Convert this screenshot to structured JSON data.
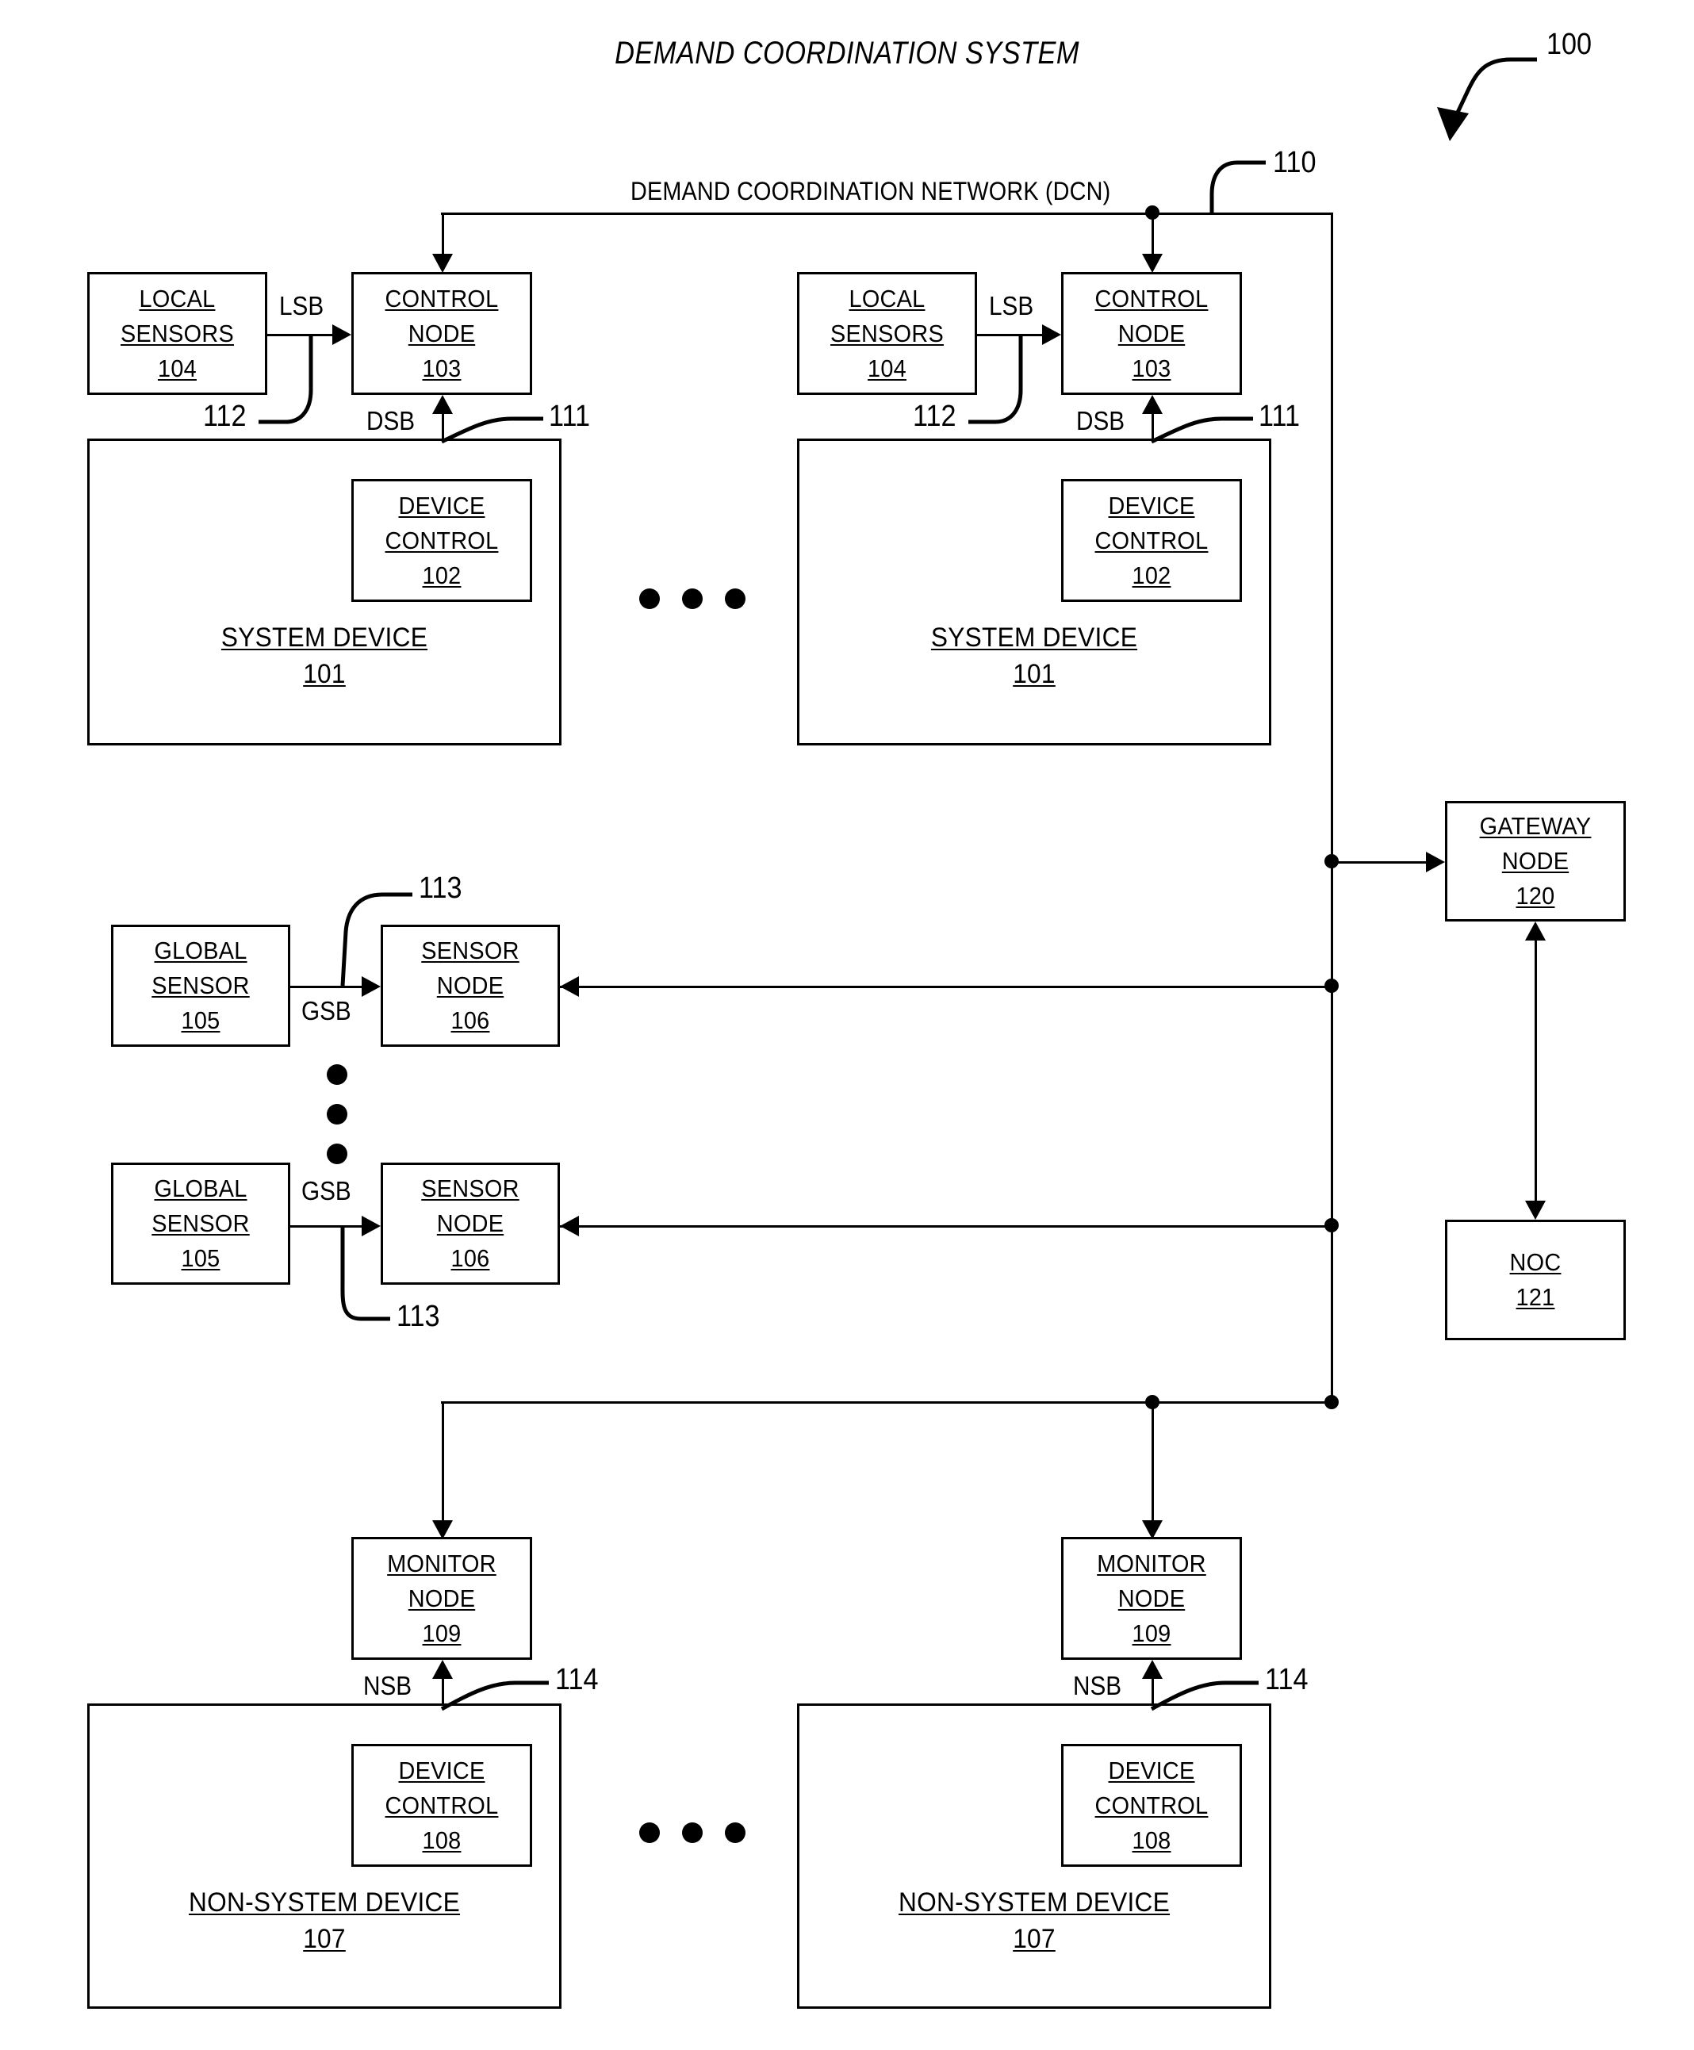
{
  "figure": {
    "title": "DEMAND COORDINATION SYSTEM",
    "figure_ref": "100"
  },
  "network": {
    "label": "DEMAND COORDINATION NETWORK (DCN)",
    "ref": "110"
  },
  "bus_labels": {
    "lsb": "LSB",
    "dsb": "DSB",
    "gsb": "GSB",
    "nsb": "NSB"
  },
  "refs": {
    "dsb_ref": "111",
    "lsb_ref": "112",
    "gsb_ref": "113",
    "nsb_ref": "114"
  },
  "system_branch": {
    "local_sensors": {
      "line1": "LOCAL",
      "line2": "SENSORS",
      "num": "104"
    },
    "control_node": {
      "line1": "CONTROL",
      "line2": "NODE",
      "num": "103"
    },
    "device_control": {
      "line1": "DEVICE",
      "line2": "CONTROL",
      "num": "102"
    },
    "system_device": {
      "line1": "SYSTEM DEVICE",
      "num": "101"
    }
  },
  "sensor_branch": {
    "global_sensor": {
      "line1": "GLOBAL",
      "line2": "SENSOR",
      "num": "105"
    },
    "sensor_node": {
      "line1": "SENSOR",
      "line2": "NODE",
      "num": "106"
    }
  },
  "nonsystem_branch": {
    "monitor_node": {
      "line1": "MONITOR",
      "line2": "NODE",
      "num": "109"
    },
    "device_control": {
      "line1": "DEVICE",
      "line2": "CONTROL",
      "num": "108"
    },
    "nonsystem_device": {
      "line1": "NON-SYSTEM DEVICE",
      "num": "107"
    }
  },
  "gateway": {
    "gateway_node": {
      "line1": "GATEWAY",
      "line2": "NODE",
      "num": "120"
    },
    "noc": {
      "line1": "NOC",
      "num": "121"
    }
  }
}
